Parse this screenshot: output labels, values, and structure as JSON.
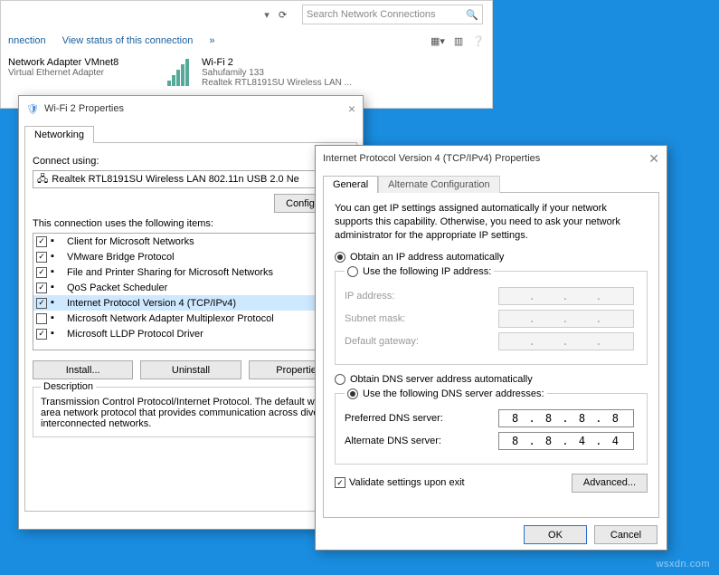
{
  "nc": {
    "search_placeholder": "Search Network Connections",
    "cmd_connection": "nnection",
    "cmd_viewstatus": "View status of this connection",
    "vmnet_title": "Network Adapter VMnet8",
    "vmnet_sub": "Virtual Ethernet Adapter",
    "wifi_title": "Wi-Fi 2",
    "wifi_ssid": "Sahufamily  133",
    "wifi_adapter": "Realtek RTL8191SU Wireless LAN ..."
  },
  "wifi_dlg": {
    "title": "Wi-Fi 2 Properties",
    "tab": "Networking",
    "connect_using": "Connect using:",
    "adapter": "Realtek RTL8191SU Wireless LAN 802.11n USB 2.0 Ne",
    "configure": "Configure...",
    "items_label": "This connection uses the following items:",
    "items": [
      {
        "checked": true,
        "label": "Client for Microsoft Networks"
      },
      {
        "checked": true,
        "label": "VMware Bridge Protocol"
      },
      {
        "checked": true,
        "label": "File and Printer Sharing for Microsoft Networks"
      },
      {
        "checked": true,
        "label": "QoS Packet Scheduler"
      },
      {
        "checked": true,
        "label": "Internet Protocol Version 4 (TCP/IPv4)",
        "selected": true
      },
      {
        "checked": false,
        "label": "Microsoft Network Adapter Multiplexor Protocol"
      },
      {
        "checked": true,
        "label": "Microsoft LLDP Protocol Driver"
      }
    ],
    "install": "Install...",
    "uninstall": "Uninstall",
    "properties": "Properties",
    "desc_title": "Description",
    "desc_text": "Transmission Control Protocol/Internet Protocol. The default wide area network protocol that provides communication across diverse interconnected networks."
  },
  "tcp_dlg": {
    "title": "Internet Protocol Version 4 (TCP/IPv4) Properties",
    "tabs": [
      "General",
      "Alternate Configuration"
    ],
    "intro": "You can get IP settings assigned automatically if your network supports this capability. Otherwise, you need to ask your network administrator for the appropriate IP settings.",
    "ip_auto": "Obtain an IP address automatically",
    "ip_manual": "Use the following IP address:",
    "ip_label": "IP address:",
    "mask_label": "Subnet mask:",
    "gw_label": "Default gateway:",
    "dns_auto": "Obtain DNS server address automatically",
    "dns_manual": "Use the following DNS server addresses:",
    "dns_pref_label": "Preferred DNS server:",
    "dns_alt_label": "Alternate DNS server:",
    "dns_pref": "8 . 8 . 8 . 8",
    "dns_alt": "8 . 8 . 4 . 4",
    "validate": "Validate settings upon exit",
    "advanced": "Advanced...",
    "ok": "OK",
    "cancel": "Cancel"
  },
  "watermark": "wsxdn.com"
}
